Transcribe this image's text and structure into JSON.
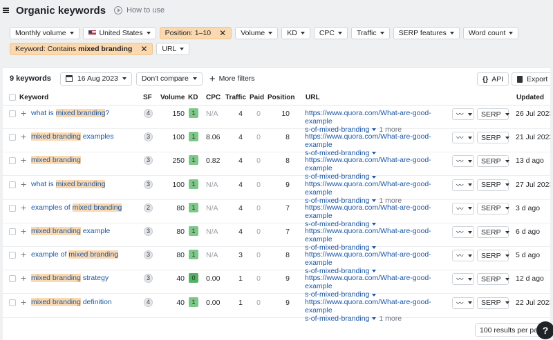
{
  "header": {
    "title": "Organic keywords",
    "how_to_use": "How to use"
  },
  "filters": {
    "monthly_volume": "Monthly volume",
    "country": "United States",
    "position": "Position: 1–10",
    "volume": "Volume",
    "kd": "KD",
    "cpc": "CPC",
    "traffic": "Traffic",
    "serp_features": "SERP features",
    "word_count": "Word count",
    "keyword_prefix": "Keyword: Contains",
    "keyword_value": "mixed branding",
    "url": "URL"
  },
  "toolbar": {
    "count": "9 keywords",
    "date": "16 Aug 2023",
    "compare": "Don't compare",
    "more_filters": "More filters",
    "api": "API",
    "export": "Export"
  },
  "columns": [
    "Keyword",
    "SF",
    "Volume",
    "KD",
    "CPC",
    "Traffic",
    "Paid",
    "Position",
    "URL",
    "Updated"
  ],
  "rows": [
    {
      "pre": "what is ",
      "hl": "mixed branding",
      "post": "?",
      "sf": "4",
      "volume": "150",
      "kd": "1",
      "cpc": "N/A",
      "traffic": "4",
      "paid": "0",
      "position": "10",
      "url1": "https://www.quora.com/What-are-good-example",
      "url2": "s-of-mixed-branding",
      "more": "1 more",
      "updated": "26 Jul 2023"
    },
    {
      "pre": "",
      "hl": "mixed branding",
      "post": " examples",
      "sf": "3",
      "volume": "100",
      "kd": "1",
      "cpc": "8.06",
      "traffic": "4",
      "paid": "0",
      "position": "8",
      "url1": "https://www.quora.com/What-are-good-example",
      "url2": "s-of-mixed-branding",
      "more": "",
      "updated": "21 Jul 2023"
    },
    {
      "pre": "",
      "hl": "mixed branding",
      "post": "",
      "sf": "3",
      "volume": "250",
      "kd": "1",
      "cpc": "0.82",
      "traffic": "4",
      "paid": "0",
      "position": "8",
      "url1": "https://www.quora.com/What-are-good-example",
      "url2": "s-of-mixed-branding",
      "more": "",
      "updated": "13 d ago"
    },
    {
      "pre": "what is ",
      "hl": "mixed branding",
      "post": "",
      "sf": "3",
      "volume": "100",
      "kd": "1",
      "cpc": "N/A",
      "traffic": "4",
      "paid": "0",
      "position": "9",
      "url1": "https://www.quora.com/What-are-good-example",
      "url2": "s-of-mixed-branding",
      "more": "1 more",
      "updated": "27 Jul 2023"
    },
    {
      "pre": "examples of ",
      "hl": "mixed branding",
      "post": "",
      "sf": "2",
      "volume": "80",
      "kd": "1",
      "cpc": "N/A",
      "traffic": "4",
      "paid": "0",
      "position": "7",
      "url1": "https://www.quora.com/What-are-good-example",
      "url2": "s-of-mixed-branding",
      "more": "",
      "updated": "3 d ago"
    },
    {
      "pre": "",
      "hl": "mixed branding",
      "post": " example",
      "sf": "3",
      "volume": "80",
      "kd": "1",
      "cpc": "N/A",
      "traffic": "4",
      "paid": "0",
      "position": "7",
      "url1": "https://www.quora.com/What-are-good-example",
      "url2": "s-of-mixed-branding",
      "more": "",
      "updated": "6 d ago"
    },
    {
      "pre": "example of ",
      "hl": "mixed branding",
      "post": "",
      "sf": "3",
      "volume": "80",
      "kd": "1",
      "cpc": "N/A",
      "traffic": "3",
      "paid": "0",
      "position": "8",
      "url1": "https://www.quora.com/What-are-good-example",
      "url2": "s-of-mixed-branding",
      "more": "",
      "updated": "5 d ago"
    },
    {
      "pre": "",
      "hl": "mixed branding",
      "post": " strategy",
      "sf": "3",
      "volume": "40",
      "kd": "0",
      "cpc": "0.00",
      "traffic": "1",
      "paid": "0",
      "position": "9",
      "url1": "https://www.quora.com/What-are-good-example",
      "url2": "s-of-mixed-branding",
      "more": "",
      "updated": "12 d ago"
    },
    {
      "pre": "",
      "hl": "mixed branding",
      "post": " definition",
      "sf": "4",
      "volume": "40",
      "kd": "1",
      "cpc": "0.00",
      "traffic": "1",
      "paid": "0",
      "position": "9",
      "url1": "https://www.quora.com/What-are-good-example",
      "url2": "s-of-mixed-branding",
      "more": "1 more",
      "updated": "22 Jul 2023"
    }
  ],
  "row_buttons": {
    "serp": "SERP"
  },
  "pagination": {
    "per_page": "100 results per page"
  },
  "help": {
    "label": "?"
  },
  "colors": {
    "highlight": "#fbd9b0",
    "link": "#1b57a6",
    "kd_easy": "#7ec78a"
  }
}
